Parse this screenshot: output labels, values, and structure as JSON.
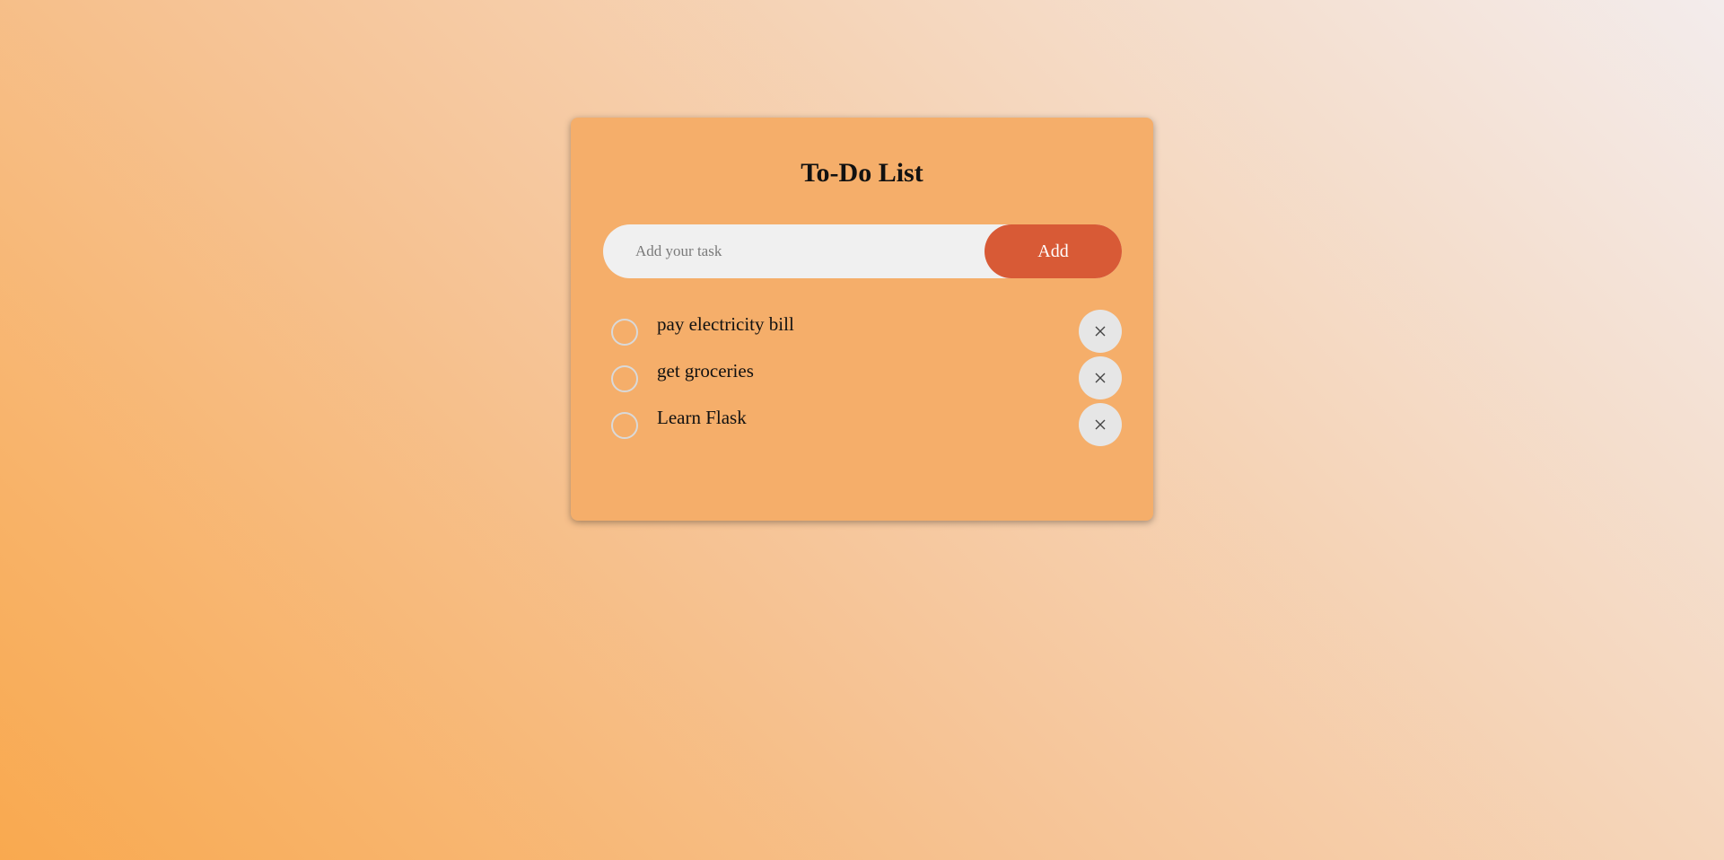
{
  "app": {
    "title": "To-Do List"
  },
  "input": {
    "placeholder": "Add your task",
    "value": ""
  },
  "add_button": {
    "label": "Add"
  },
  "tasks": [
    {
      "text": "pay electricity bill",
      "done": false
    },
    {
      "text": "get groceries",
      "done": false
    },
    {
      "text": "Learn Flask",
      "done": false
    }
  ],
  "icons": {
    "task_check": "circle-icon",
    "task_delete": "close-icon"
  },
  "colors": {
    "card_background": "#f5ae6a",
    "add_button": "#d85a36",
    "input_background": "#f0f0f0",
    "delete_button": "#e6e6e6"
  }
}
